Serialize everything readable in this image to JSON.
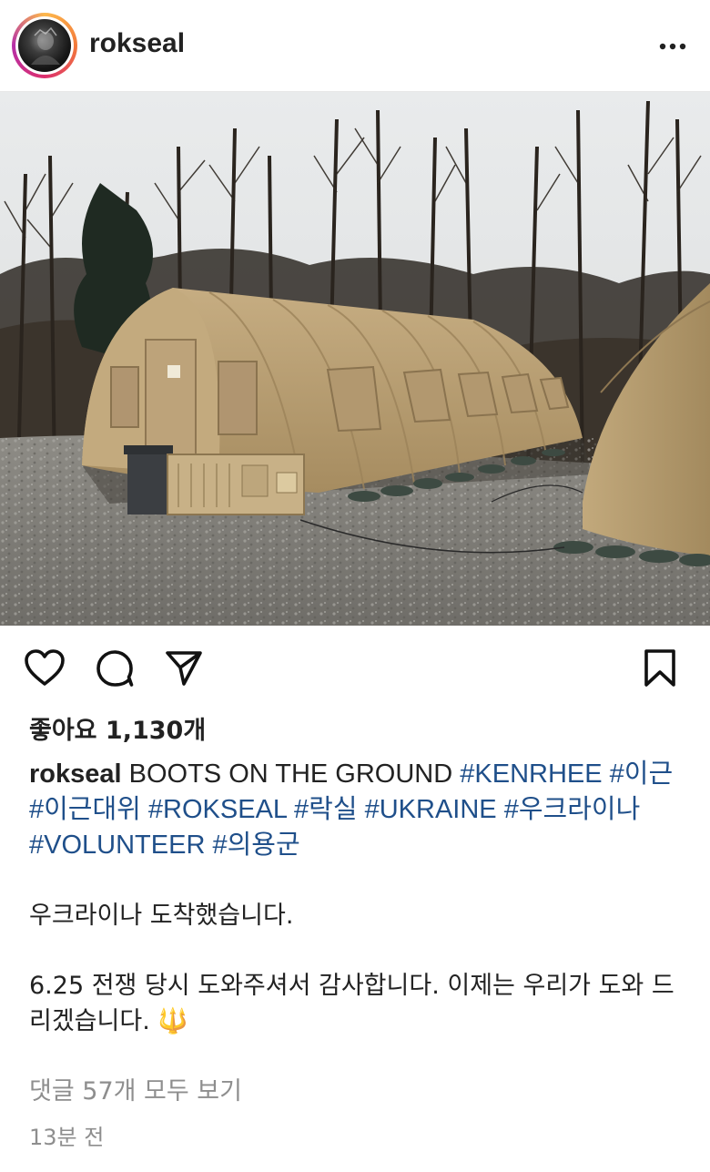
{
  "post": {
    "username": "rokseal",
    "likes": "좋아요 1,130개",
    "caption": {
      "username": "rokseal",
      "text": "BOOTS ON THE GROUND",
      "hashtags": [
        "#KENRHEE",
        "#이근",
        "#이근대위",
        "#ROKSEAL",
        "#락실",
        "#UKRAINE",
        "#우크라이나",
        "#VOLUNTEER",
        "#의용군"
      ],
      "line1": "우크라이나 도착했습니다.",
      "line2": "6.25 전쟁 당시 도와주셔서 감사합니다. 이제는 우리가 도와 드리겠습니다.",
      "emoji": "🔱"
    },
    "comments_link": "댓글 57개 모두 보기",
    "timestamp": "13분 전"
  },
  "icons": {
    "more": "more-dots-icon",
    "like": "heart-icon",
    "comment": "comment-bubble-icon",
    "share": "send-icon",
    "save": "bookmark-icon"
  },
  "colors": {
    "hashtag": "#1f4f8a",
    "secondary_text": "#8e8e8e",
    "tent": "#b69a6c"
  }
}
